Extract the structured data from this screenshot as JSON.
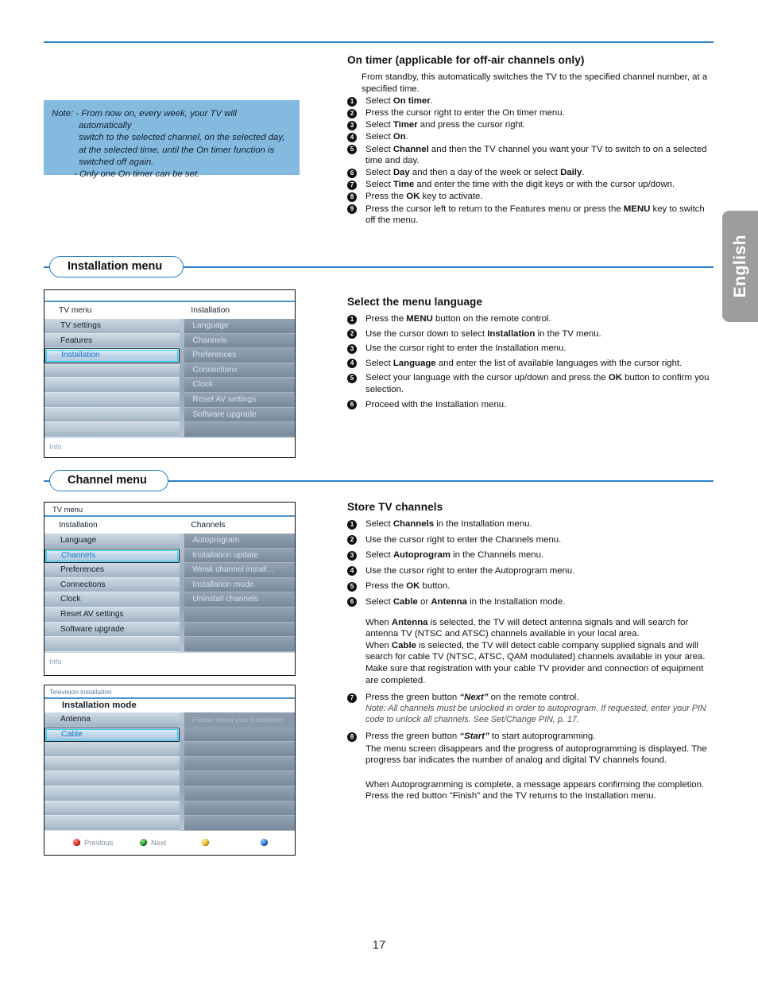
{
  "page": {
    "number": "17",
    "language_tab": "English"
  },
  "colors": {
    "accent": "#2a7fc9",
    "note_bg": "#84b9e0",
    "tab_bg": "#9d9d9d",
    "select_highlight": "#2bd0f5"
  },
  "note": {
    "line1": "Note: - From now on, every week, your TV will automatically",
    "line2": "switch to the selected channel, on the selected day,",
    "line3": "at the selected time, until the On timer function is",
    "line4": "switched off again.",
    "line5": "- Only one On timer can be set."
  },
  "on_timer": {
    "heading": "On timer (applicable for off-air channels only)",
    "intro": "From standby, this automatically switches the TV to the specified channel number, at a specified time.",
    "steps": [
      "Select On timer.",
      "Press the cursor right to enter the On timer menu.",
      "Select Timer and press the cursor right.",
      "Select On.",
      "Select Channel and then the TV channel you want your TV to switch to on a selected time and day.",
      "Select Day and then a day of the week or select Daily.",
      "Select Time and enter the time with the digit keys or with the cursor up/down.",
      "Press the OK key to activate.",
      "Press the cursor left to return to the Features menu or press the MENU key to switch off the menu."
    ]
  },
  "sections": {
    "installation_menu": "Installation menu",
    "channel_menu": "Channel menu"
  },
  "select_language": {
    "heading": "Select the menu language",
    "steps": [
      "Press the MENU button on the remote control.",
      "Use the cursor down to select Installation in the TV menu.",
      "Use the cursor right to enter the Installation menu.",
      "Select Language and enter the list of available languages with the cursor right.",
      "Select your language with the cursor up/down and press the OK button to confirm you selection.",
      "Proceed with the Installation menu."
    ]
  },
  "store_channels": {
    "heading": "Store TV channels",
    "steps": [
      "Select Channels in the Installation menu.",
      "Use the cursor right to enter the Channels menu.",
      "Select Autoprogram in the Channels menu.",
      "Use the cursor right to enter the Autoprogram menu.",
      "Press the OK button.",
      "Select Cable or Antenna in the Installation mode."
    ],
    "para_antenna": "When Antenna is selected, the TV will detect antenna signals and will search for antenna TV (NTSC and ATSC) channels available in your local area.",
    "para_cable": "When Cable is selected, the TV will detect cable company supplied signals and will search for cable TV (NTSC, ATSC, QAM modulated) channels available in your area.",
    "para_register": "Make sure that registration with your cable TV provider and connection of equipment are completed.",
    "step7": "Press the green button “Next” on the remote control.",
    "step7_note": "Note: All channels must be unlocked in order to autoprogram. If requested, enter your PIN code to unlock all channels. See Set/Change PIN, p. 17.",
    "step8": "Press the green button “Start” to start autoprogramming.",
    "step8_body": "The menu screen disappears and the progress of autoprogramming is displayed. The progress bar indicates the number of analog and digital TV channels found.",
    "final_para": "When Autoprogramming is complete, a message appears confirming the completion. Press the red button \"Finish\" and the TV returns to the Installation menu."
  },
  "tv_screens": {
    "installation": {
      "left_title": "TV menu",
      "right_title": "Installation",
      "left_items": [
        "TV settings",
        "Features",
        "Installation",
        "",
        "",
        "",
        "",
        ""
      ],
      "left_selected_index": 2,
      "right_items": [
        "Language",
        "Channels",
        "Preferences",
        "Connections",
        "Clock",
        "Reset AV settings",
        "Software upgrade",
        ""
      ],
      "info_label": "Info"
    },
    "channels": {
      "top_title": "TV menu",
      "left_title": "Installation",
      "right_title": "Channels",
      "left_items": [
        "Language",
        "Channels",
        "Preferences",
        "Connections",
        "Clock",
        "Reset AV settings",
        "Software upgrade",
        ""
      ],
      "left_selected_index": 1,
      "right_items": [
        "Autoprogram",
        "Installation update",
        "Weak channel install...",
        "Installation mode",
        "Uninstall channels",
        "",
        "",
        ""
      ],
      "info_label": "Info"
    },
    "install_mode": {
      "top_title": "Television installation",
      "heading": "Installation mode",
      "left_items": [
        "Antenna",
        "Cable",
        "",
        "",
        "",
        "",
        "",
        ""
      ],
      "left_selected_index": 1,
      "hint": "Please select your installation mode",
      "buttons": [
        {
          "color": "red",
          "label": "Previous"
        },
        {
          "color": "green",
          "label": "Next"
        },
        {
          "color": "yellow",
          "label": ""
        },
        {
          "color": "blue",
          "label": ""
        }
      ]
    }
  }
}
